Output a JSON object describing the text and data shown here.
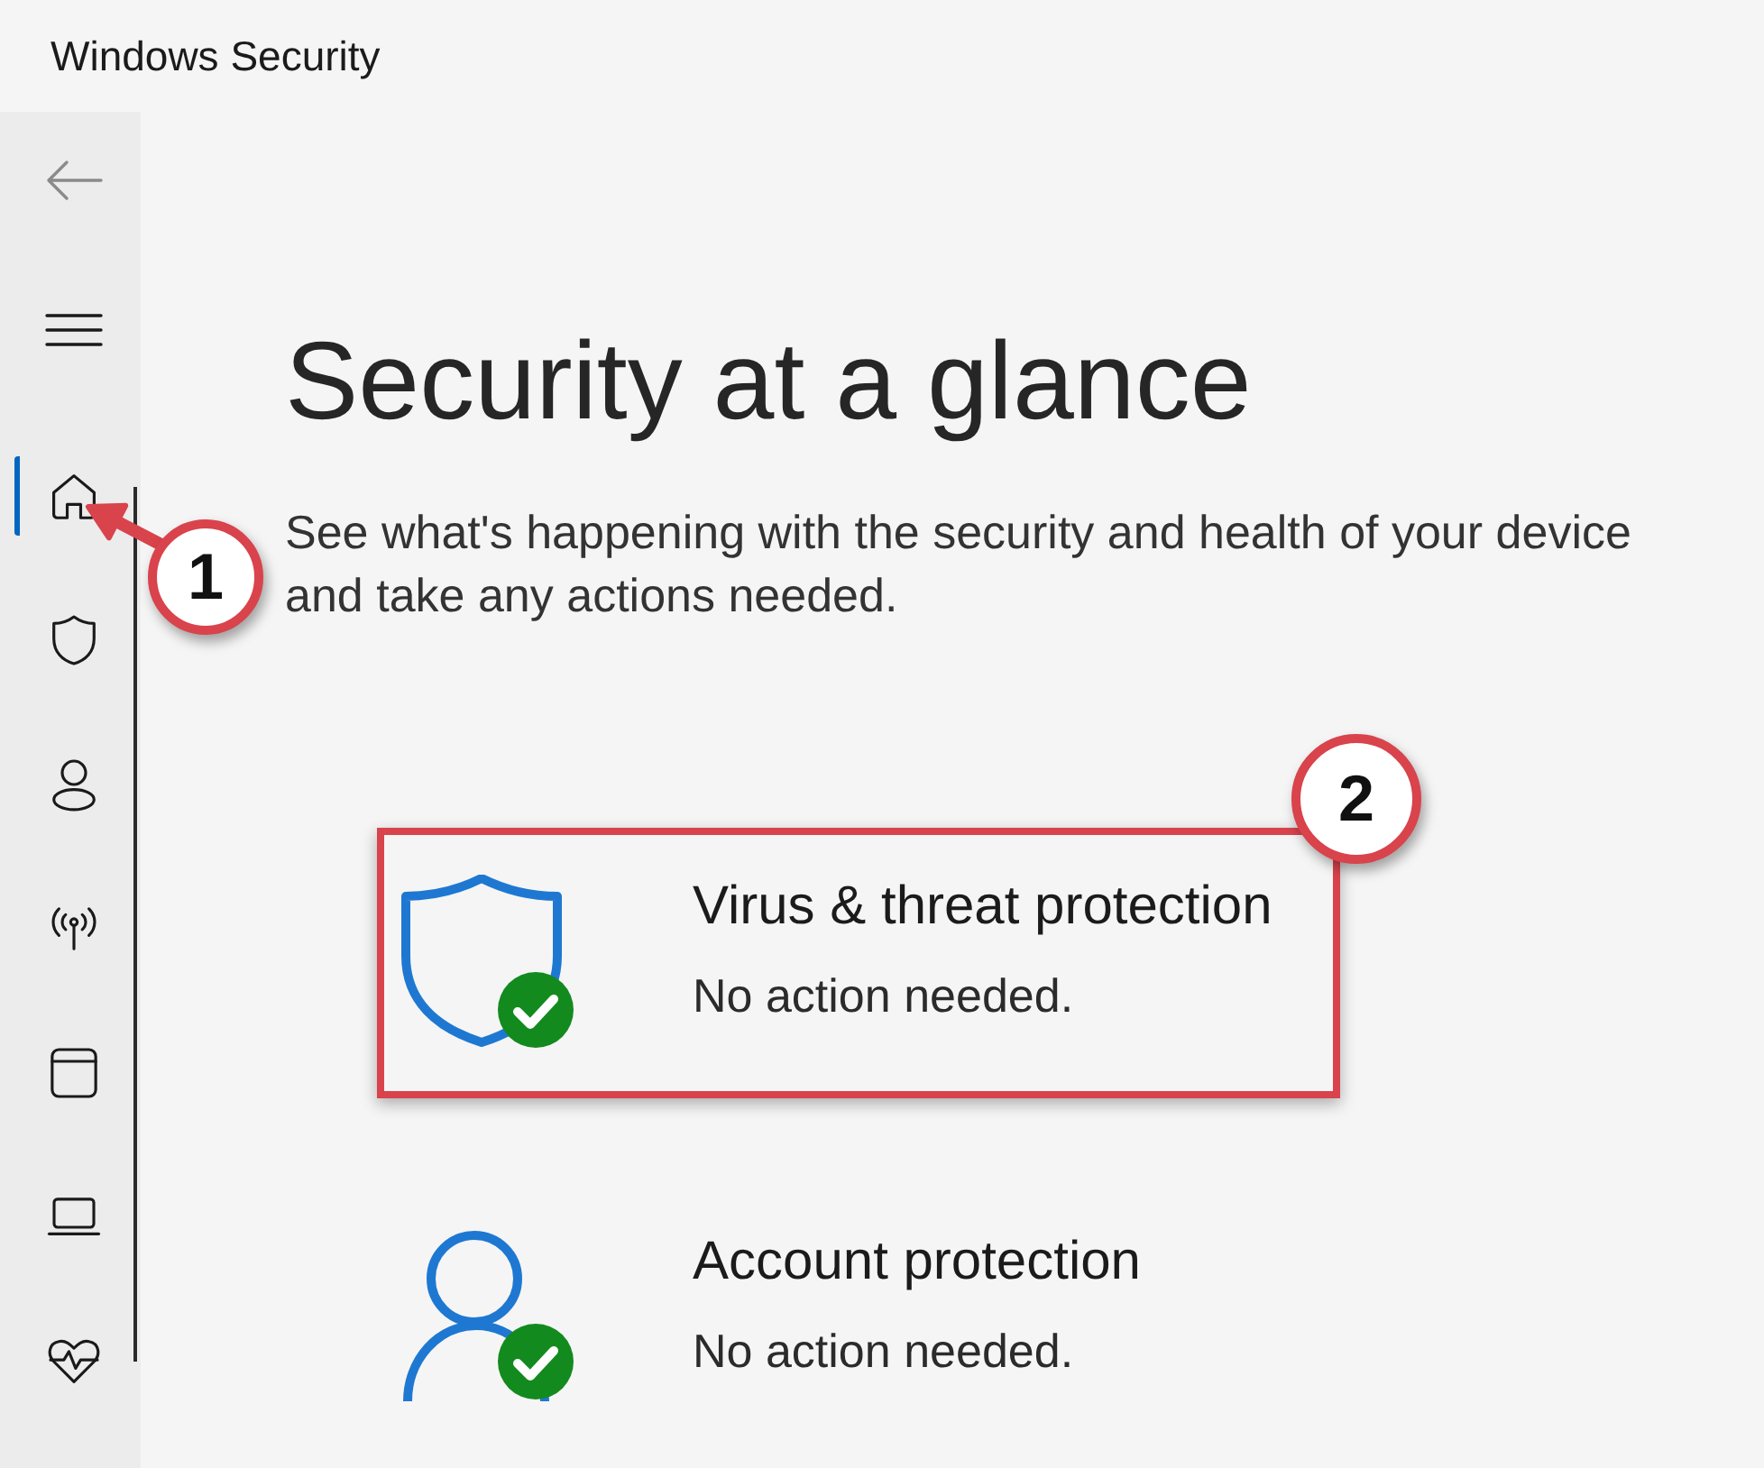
{
  "window": {
    "title": "Windows Security"
  },
  "sidebar": {
    "items": [
      {
        "kind": "home",
        "selected": true,
        "callout": "1"
      },
      {
        "kind": "shield",
        "selected": false
      },
      {
        "kind": "account",
        "selected": false
      },
      {
        "kind": "network",
        "selected": false
      },
      {
        "kind": "app",
        "selected": false
      },
      {
        "kind": "device",
        "selected": false
      },
      {
        "kind": "health",
        "selected": false
      }
    ]
  },
  "page": {
    "heading": "Security at a glance",
    "description": "See what's happening with the security and health of your device and take any actions needed.",
    "tiles": [
      {
        "kind": "virus",
        "title": "Virus & threat protection",
        "status": "No action needed.",
        "ok": true,
        "highlighted": true,
        "callout": "2"
      },
      {
        "kind": "account",
        "title": "Account protection",
        "status": "No action needed.",
        "ok": true,
        "highlighted": false
      }
    ]
  }
}
